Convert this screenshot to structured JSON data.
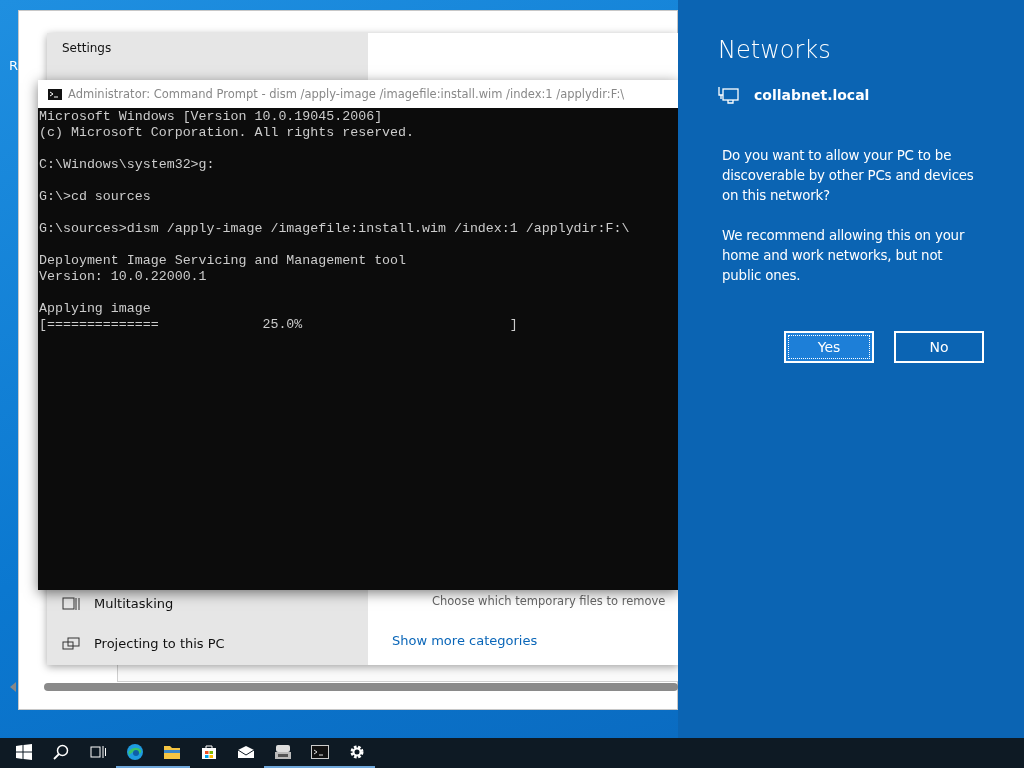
{
  "desktop": {
    "icon_labels": [
      "R"
    ]
  },
  "settings_window": {
    "title": "Settings",
    "sidebar": [
      {
        "label": "Multitasking",
        "kind": "multitasking"
      },
      {
        "label": "Projecting to this PC",
        "kind": "projecting"
      }
    ],
    "storage_hint": "Choose which temporary files to remove",
    "link": "Show more categories"
  },
  "console_window": {
    "title": "Administrator: Command Prompt - dism  /apply-image /imagefile:install.wim /index:1 /applydir:F:\\",
    "blocks": [
      [
        "Microsoft Windows [Version 10.0.19045.2006]",
        "(c) Microsoft Corporation. All rights reserved."
      ],
      [
        "C:\\Windows\\system32>g:"
      ],
      [
        "G:\\>cd sources"
      ],
      [
        "G:\\sources>dism /apply-image /imagefile:install.wim /index:1 /applydir:F:\\"
      ],
      [
        "Deployment Image Servicing and Management tool",
        "Version: 10.0.22000.1"
      ],
      [
        "Applying image",
        "[==============             25.0%                          ]"
      ]
    ]
  },
  "network_flyout": {
    "title": "Networks",
    "network": "collabnet.local",
    "question": "Do you want to allow your PC to be discoverable by other PCs and devices on this network?",
    "recommendation": "We recommend allowing this on your home and work networks, but not public ones.",
    "buttons": [
      {
        "label": "Yes",
        "selected": true
      },
      {
        "label": "No",
        "selected": false
      }
    ]
  },
  "taskbar": {
    "items": [
      {
        "kind": "start",
        "running": false
      },
      {
        "kind": "search",
        "running": false
      },
      {
        "kind": "taskview",
        "running": false
      },
      {
        "kind": "edge",
        "running": true
      },
      {
        "kind": "explorer",
        "running": true
      },
      {
        "kind": "store",
        "running": false
      },
      {
        "kind": "mail",
        "running": false
      },
      {
        "kind": "app",
        "running": true
      },
      {
        "kind": "console",
        "running": true
      },
      {
        "kind": "settings",
        "running": true
      }
    ]
  }
}
